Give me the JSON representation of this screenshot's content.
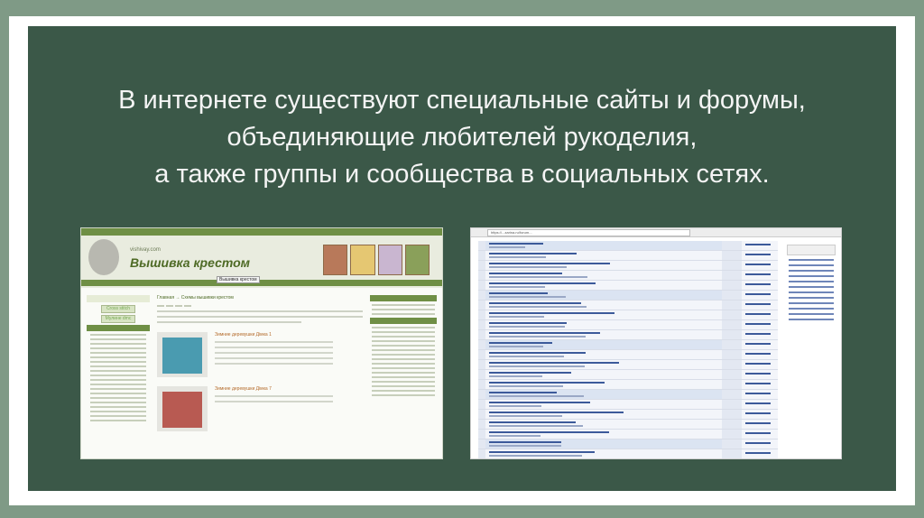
{
  "slide": {
    "title_lines": [
      "В интернете существуют специальные сайты и форумы,",
      "объединяющие любителей рукоделия,",
      "а также группы и сообщества в социальных сетях."
    ]
  },
  "left_screenshot": {
    "site_url": "vishivay.com",
    "site_name": "Вышивка крестом",
    "tooltip": "Вышивка крестом",
    "breadcrumb": "Главная → Схемы вышивки крестом",
    "sidebar_buttons": [
      "Cross stitch",
      "Мулине dmc"
    ],
    "item_titles": [
      "Зимние деревушки Дімка 1",
      "Зимние деревушки Дімка 7"
    ]
  },
  "right_screenshot": {
    "address": "https://...zarina.ru/forum..."
  },
  "colors": {
    "page_bg": "#7f9a86",
    "slide_bg": "#3b5848",
    "title_text": "#f4f4f4",
    "site_green": "#6f8f45",
    "forum_blue": "#3c5a9a"
  }
}
